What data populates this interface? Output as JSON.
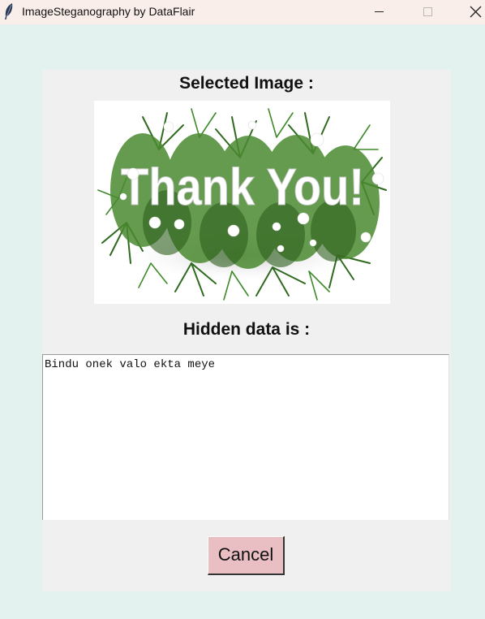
{
  "window": {
    "title": "ImageSteganography by DataFlair",
    "icon": "feather-icon",
    "controls": [
      "minimize-icon",
      "maximize-icon",
      "close-icon"
    ]
  },
  "panel": {
    "selected_image_label": "Selected Image :",
    "image": {
      "description_text": "Thank You!",
      "decoration": "pine-branches-with-snowflakes"
    },
    "hidden_data_label": "Hidden data is :",
    "hidden_data_text": "Bindu onek valo ekta meye",
    "cancel_label": "Cancel"
  },
  "colors": {
    "background": "#e3f2ee",
    "titlebar": "#f9eeea",
    "panel": "#f0f0f0",
    "cancel_button": "#e9bfc3"
  }
}
